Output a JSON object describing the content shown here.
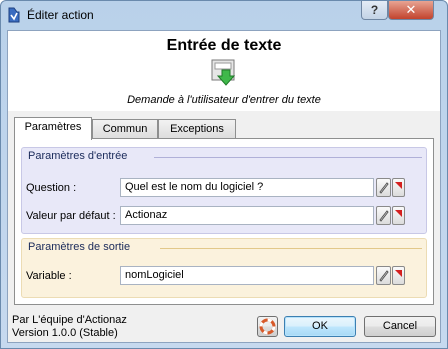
{
  "window": {
    "title": "Éditer action",
    "help_glyph": "?",
    "close_glyph": "✕"
  },
  "header": {
    "title": "Entrée de texte",
    "description": "Demande à l'utilisateur d'entrer du texte"
  },
  "tabs": [
    {
      "label": "Paramètres",
      "active": true
    },
    {
      "label": "Commun",
      "active": false
    },
    {
      "label": "Exceptions",
      "active": false
    }
  ],
  "input_params": {
    "title": "Paramètres d'entrée",
    "fields": [
      {
        "label": "Question :",
        "value": "Quel est le nom du logiciel ?"
      },
      {
        "label": "Valeur par défaut :",
        "value": "Actionaz"
      }
    ]
  },
  "output_params": {
    "title": "Paramètres de sortie",
    "fields": [
      {
        "label": "Variable :",
        "value": "nomLogiciel"
      }
    ]
  },
  "footer": {
    "author": "Par L'équipe d'Actionaz",
    "version": "Version 1.0.0 (Stable)",
    "ok_label": "OK",
    "cancel_label": "Cancel"
  },
  "colors": {
    "input_group_bg": "#e8e8f8",
    "output_group_bg": "#fbf2dd",
    "flag_red": "#d42020"
  }
}
